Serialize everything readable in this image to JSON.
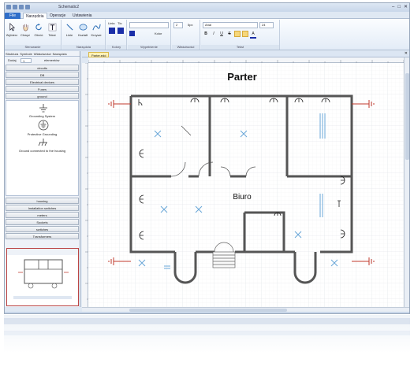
{
  "window": {
    "title": "Schematic2"
  },
  "ribbon_tabs": [
    {
      "label": "File"
    },
    {
      "label": "Narzędzia"
    },
    {
      "label": "Operacje"
    },
    {
      "label": "Ustawienia"
    }
  ],
  "ribbon": {
    "buttons": {
      "select": "Wybierz",
      "pan": "Chwyć",
      "rotate": "Obróć",
      "text": "Tekst",
      "line": "Linie",
      "shapes": "Kształt",
      "curves": "Krzywe"
    },
    "line_label": "Linia",
    "fill_label": "Tło",
    "color_label": "Kolor",
    "width_value": "2",
    "unit_label": "5px",
    "font_name": "Arial",
    "font_size": "24",
    "bold": "B",
    "italic": "I",
    "underline": "U",
    "strike": "S",
    "font_color": "A",
    "groups": [
      "Sterowanie",
      "Narzędzia",
      "Kolory",
      "Wypełnienie",
      "Właściwości",
      "Tekst"
    ]
  },
  "left_panel": {
    "tabs": [
      "Struktura",
      "Symbole",
      "Właściwości",
      "Narzędzia"
    ],
    "add_label": "Dodaj",
    "add_value": "1",
    "elements_label": "elementów",
    "categories_top": [
      "circuits",
      "DB",
      "Electrical devices",
      "Fuses",
      "ground"
    ],
    "symbols": [
      {
        "label": "Grounding System"
      },
      {
        "label": "Protective Grounding"
      },
      {
        "label": "Ground connected to the housing"
      }
    ],
    "categories_bottom": [
      "housing",
      "Installation switches",
      "meters",
      "Sockets",
      "switches",
      "Transformers"
    ]
  },
  "document_tabs": [
    {
      "label": "Parter.edd"
    }
  ],
  "plan": {
    "title": "Parter",
    "room_label": "Biuro"
  },
  "colors": {
    "accent": "#2f6ec9",
    "wall": "#555555",
    "grounding": "#c0392b",
    "lamp": "#6aa7d8"
  }
}
